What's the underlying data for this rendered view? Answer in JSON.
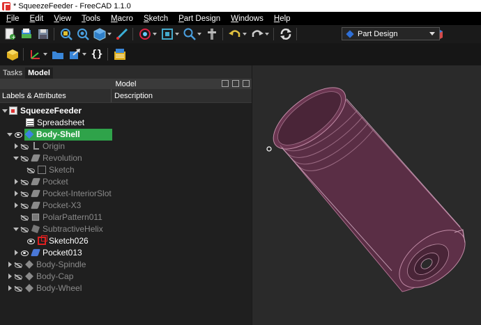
{
  "window": {
    "title": "* SqueezeFeeder - FreeCAD 1.1.0"
  },
  "menu": [
    {
      "u": "F",
      "rest": "ile"
    },
    {
      "u": "E",
      "rest": "dit"
    },
    {
      "u": "V",
      "rest": "iew"
    },
    {
      "u": "T",
      "rest": "ools"
    },
    {
      "u": "M",
      "rest": "acro"
    },
    {
      "u": "S",
      "rest": "ketch"
    },
    {
      "u": "P",
      "rest": "art Design"
    },
    {
      "u": "W",
      "rest": "indows"
    },
    {
      "u": "H",
      "rest": "elp"
    }
  ],
  "workbench": {
    "selected": "Part Design"
  },
  "toolbar2": {
    "braces_label": "{}"
  },
  "panel": {
    "tabs": [
      "Tasks",
      "Model"
    ],
    "active_tab": "Model",
    "header": "Model",
    "col_labels": "Labels & Attributes",
    "col_description": "Description"
  },
  "tree": [
    {
      "label": "SqueezeFeeder",
      "style": "bold",
      "icon": "document-icon",
      "depth": 0,
      "expander": "down",
      "visibility": "none"
    },
    {
      "label": "Spreadsheet",
      "style": "norm",
      "icon": "spreadsheet-icon",
      "depth": 1,
      "expander": "none",
      "visibility": "none"
    },
    {
      "label": "Body-Shell",
      "style": "bold",
      "icon": "body-icon",
      "depth": 1,
      "expander": "down",
      "visibility": "eye",
      "highlight": true
    },
    {
      "label": "Origin",
      "style": "dim",
      "icon": "origin-icon",
      "depth": 2,
      "expander": "right",
      "visibility": "hide"
    },
    {
      "label": "Revolution",
      "style": "dim",
      "icon": "revolution-icon",
      "depth": 2,
      "expander": "down",
      "visibility": "hide"
    },
    {
      "label": "Sketch",
      "style": "dim",
      "icon": "sketch-icon",
      "depth": 3,
      "expander": "none",
      "visibility": "hide"
    },
    {
      "label": "Pocket",
      "style": "dim",
      "icon": "pocket-icon",
      "depth": 2,
      "expander": "right",
      "visibility": "hide"
    },
    {
      "label": "Pocket-InteriorSlot",
      "style": "dim",
      "icon": "pocket-icon",
      "depth": 2,
      "expander": "right",
      "visibility": "hide"
    },
    {
      "label": "Pocket-X3",
      "style": "dim",
      "icon": "pocket-icon",
      "depth": 2,
      "expander": "right",
      "visibility": "hide"
    },
    {
      "label": "PolarPattern011",
      "style": "dim",
      "icon": "polar-pattern-icon",
      "depth": 2,
      "expander": "none",
      "visibility": "hide"
    },
    {
      "label": "SubtractiveHelix",
      "style": "dim",
      "icon": "helix-icon",
      "depth": 2,
      "expander": "down",
      "visibility": "hide"
    },
    {
      "label": "Sketch026",
      "style": "norm",
      "icon": "sketch-red-icon",
      "depth": 3,
      "expander": "none",
      "visibility": "eye"
    },
    {
      "label": "Pocket013",
      "style": "norm",
      "icon": "pocket-active-icon",
      "depth": 2,
      "expander": "right",
      "visibility": "eye"
    },
    {
      "label": "Body-Spindle",
      "style": "dim",
      "icon": "body-dim-icon",
      "depth": 1,
      "expander": "right",
      "visibility": "hide"
    },
    {
      "label": "Body-Cap",
      "style": "dim",
      "icon": "body-dim-icon",
      "depth": 1,
      "expander": "right",
      "visibility": "hide"
    },
    {
      "label": "Body-Wheel",
      "style": "dim",
      "icon": "body-dim-icon",
      "depth": 1,
      "expander": "right",
      "visibility": "hide"
    }
  ],
  "viewport": {
    "model_color": "#6a3550",
    "edge_color": "#b07090",
    "background": "#2a2a2a"
  }
}
